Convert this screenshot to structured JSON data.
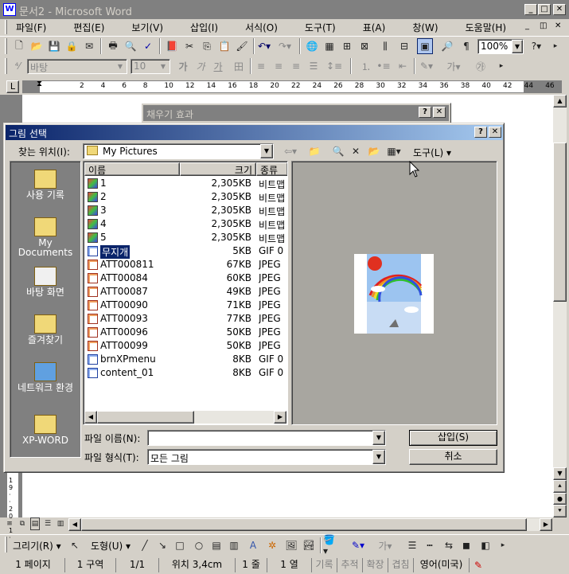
{
  "window": {
    "title": "문서2 - Microsoft Word"
  },
  "menu": [
    "파일(F)",
    "편집(E)",
    "보기(V)",
    "삽입(I)",
    "서식(O)",
    "도구(T)",
    "표(A)",
    "창(W)",
    "도움말(H)"
  ],
  "toolbar": {
    "zoom": "100%",
    "style": "바탕",
    "font_size": "10"
  },
  "ruler": {
    "ticks": [
      "2",
      "4",
      "6",
      "8",
      "10",
      "12",
      "14",
      "16",
      "18",
      "20",
      "22",
      "24",
      "26",
      "28",
      "30",
      "32",
      "34",
      "36",
      "38",
      "40",
      "42",
      "44",
      "46"
    ]
  },
  "back_dialog": {
    "title": "채우기 효과"
  },
  "dialog": {
    "title": "그림 선택",
    "look_in_label": "찾는 위치(I):",
    "look_in_value": "My Pictures",
    "tools_label": "도구(L)",
    "columns": [
      "이름",
      "크기",
      "종류"
    ],
    "files": [
      {
        "name": "1",
        "size": "2,305KB",
        "type": "비트맵",
        "icon": "bitmap"
      },
      {
        "name": "2",
        "size": "2,305KB",
        "type": "비트맵",
        "icon": "bitmap"
      },
      {
        "name": "3",
        "size": "2,305KB",
        "type": "비트맵",
        "icon": "bitmap"
      },
      {
        "name": "4",
        "size": "2,305KB",
        "type": "비트맵",
        "icon": "bitmap"
      },
      {
        "name": "5",
        "size": "2,305KB",
        "type": "비트맵",
        "icon": "bitmap"
      },
      {
        "name": "무지개",
        "size": "5KB",
        "type": "GIF 0",
        "icon": "gif",
        "selected": true
      },
      {
        "name": "ATT000811",
        "size": "67KB",
        "type": "JPEG",
        "icon": "jpeg"
      },
      {
        "name": "ATT00084",
        "size": "60KB",
        "type": "JPEG",
        "icon": "jpeg"
      },
      {
        "name": "ATT00087",
        "size": "49KB",
        "type": "JPEG",
        "icon": "jpeg"
      },
      {
        "name": "ATT00090",
        "size": "71KB",
        "type": "JPEG",
        "icon": "jpeg"
      },
      {
        "name": "ATT00093",
        "size": "77KB",
        "type": "JPEG",
        "icon": "jpeg"
      },
      {
        "name": "ATT00096",
        "size": "50KB",
        "type": "JPEG",
        "icon": "jpeg"
      },
      {
        "name": "ATT00099",
        "size": "50KB",
        "type": "JPEG",
        "icon": "jpeg"
      },
      {
        "name": "brnXPmenu",
        "size": "8KB",
        "type": "GIF 0",
        "icon": "gif"
      },
      {
        "name": "content_01",
        "size": "8KB",
        "type": "GIF 0",
        "icon": "gif"
      }
    ],
    "places": [
      {
        "label": "사용 기록",
        "icon": "history-icon"
      },
      {
        "label": "My Documents",
        "icon": "my-documents-icon"
      },
      {
        "label": "바탕 화면",
        "icon": "desktop-icon"
      },
      {
        "label": "즐겨찾기",
        "icon": "favorites-icon"
      },
      {
        "label": "네트워크 환경",
        "icon": "network-icon"
      },
      {
        "label": "XP-WORD",
        "icon": "folder-icon"
      }
    ],
    "filename_label": "파일 이름(N):",
    "filename_value": "",
    "filetype_label": "파일 형식(T):",
    "filetype_value": "모든 그림",
    "insert_button": "삽입(S)",
    "cancel_button": "취소"
  },
  "drawing_toolbar": {
    "draw_label": "그리기(R)",
    "autoshape_label": "도형(U)"
  },
  "statusbar": [
    "1 페이지",
    "1 구역",
    "1/1",
    "위치 3,4cm",
    "1 줄",
    "1 열",
    "기록",
    "추적",
    "확장",
    "겹침",
    "영어(미국)"
  ]
}
